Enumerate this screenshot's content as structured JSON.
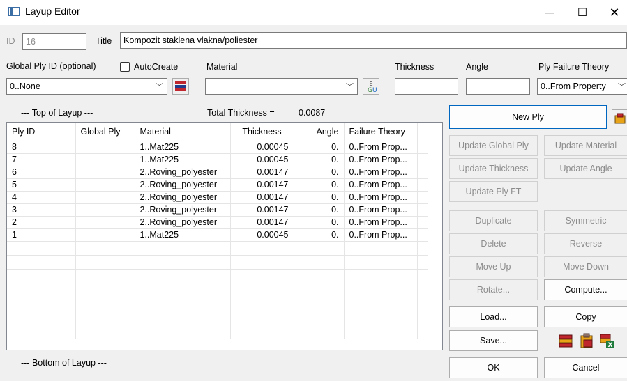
{
  "window": {
    "title": "Layup Editor",
    "minimize": "—",
    "maximize": "☐",
    "close": "✕"
  },
  "header": {
    "id_label": "ID",
    "id_value": "16",
    "title_label": "Title",
    "title_value": "Kompozit staklena vlakna/poliester"
  },
  "fields": {
    "global_ply_label": "Global Ply ID (optional)",
    "global_ply_value": "0..None",
    "autocreate_label": "AutoCreate",
    "material_label": "Material",
    "material_value": "",
    "thickness_label": "Thickness",
    "thickness_value": "",
    "angle_label": "Angle",
    "angle_value": "",
    "failure_label": "Ply Failure Theory",
    "failure_value": "0..From Property"
  },
  "layup": {
    "top_label": "--- Top of Layup ---",
    "total_label": "Total Thickness =",
    "total_value": "0.0087",
    "bottom_label": "--- Bottom of Layup ---"
  },
  "table": {
    "columns": [
      "Ply ID",
      "Global Ply",
      "Material",
      "Thickness",
      "Angle",
      "Failure Theory"
    ],
    "rows": [
      [
        "8",
        "",
        "1..Mat225",
        "0.00045",
        "0.",
        "0..From Prop..."
      ],
      [
        "7",
        "",
        "1..Mat225",
        "0.00045",
        "0.",
        "0..From Prop..."
      ],
      [
        "6",
        "",
        "2..Roving_polyester",
        "0.00147",
        "0.",
        "0..From Prop..."
      ],
      [
        "5",
        "",
        "2..Roving_polyester",
        "0.00147",
        "0.",
        "0..From Prop..."
      ],
      [
        "4",
        "",
        "2..Roving_polyester",
        "0.00147",
        "0.",
        "0..From Prop..."
      ],
      [
        "3",
        "",
        "2..Roving_polyester",
        "0.00147",
        "0.",
        "0..From Prop..."
      ],
      [
        "2",
        "",
        "2..Roving_polyester",
        "0.00147",
        "0.",
        "0..From Prop..."
      ],
      [
        "1",
        "",
        "1..Mat225",
        "0.00045",
        "0.",
        "0..From Prop..."
      ]
    ],
    "empty_rows": 7
  },
  "buttons": {
    "new_ply": "New Ply",
    "update_global_ply": "Update Global Ply",
    "update_material": "Update Material",
    "update_thickness": "Update Thickness",
    "update_angle": "Update Angle",
    "update_ply_ft": "Update Ply FT",
    "duplicate": "Duplicate",
    "symmetric": "Symmetric",
    "delete": "Delete",
    "reverse": "Reverse",
    "move_up": "Move Up",
    "move_down": "Move Down",
    "rotate": "Rotate...",
    "compute": "Compute...",
    "load": "Load...",
    "copy": "Copy",
    "save": "Save...",
    "ok": "OK",
    "cancel": "Cancel"
  },
  "icons": {
    "material_list": "material-list-icon",
    "function": "function-icon",
    "paste_ply": "paste-ply-icon",
    "stack": "stack-icon",
    "clipboard": "clipboard-icon",
    "excel": "excel-icon"
  }
}
